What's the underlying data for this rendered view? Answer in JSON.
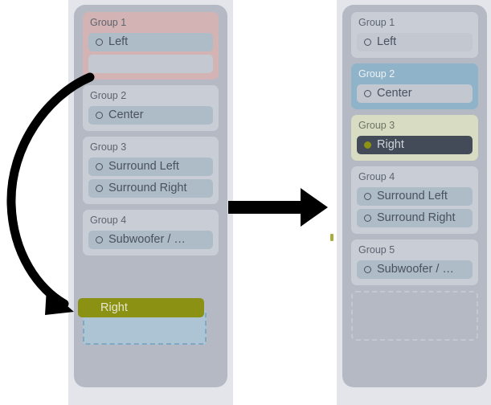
{
  "scene": {
    "description": "Drag-and-drop reordering of speaker channel groups, before and after",
    "accents": {
      "panel_bg": "#b4b9c4",
      "rail_bg": "#e3e5ea",
      "group_bg": "#c9cdd6",
      "group_rose": "#d3b3b3",
      "group_blue": "#8fb3c9",
      "group_olive": "#d8dcc2",
      "chip_bg": "#aebcc8",
      "chip_dark": "#434b58",
      "drag_olive": "#8a9113",
      "drop_fill": "#adc4d4",
      "drop_border": "#7fa8c4"
    }
  },
  "left_panel": {
    "name": "before-state",
    "groups": [
      {
        "title": "Group 1",
        "tint": "rose",
        "items": [
          {
            "label": "Left",
            "style": "chip",
            "bullet": "ring"
          }
        ],
        "ghost_slot": true
      },
      {
        "title": "Group 2",
        "tint": "none",
        "items": [
          {
            "label": "Center",
            "style": "chip",
            "bullet": "ring"
          }
        ],
        "ghost_slot": false
      },
      {
        "title": "Group 3",
        "tint": "none",
        "items": [
          {
            "label": "Surround Left",
            "style": "chip",
            "bullet": "ring"
          },
          {
            "label": "Surround Right",
            "style": "chip",
            "bullet": "ring"
          }
        ],
        "ghost_slot": false
      },
      {
        "title": "Group 4",
        "tint": "none",
        "items": [
          {
            "label": "Subwoofer / …",
            "style": "chip",
            "bullet": "ring"
          }
        ],
        "ghost_slot": false
      }
    ],
    "drag_chip_label": "Right",
    "drop_zone_label": ""
  },
  "right_panel": {
    "name": "after-state",
    "groups": [
      {
        "title": "Group 1",
        "tint": "none",
        "items": [
          {
            "label": "Left",
            "style": "chip-plain",
            "bullet": "ring"
          }
        ],
        "ghost_slot": false
      },
      {
        "title": "Group 2",
        "tint": "blue",
        "items": [
          {
            "label": "Center",
            "style": "chip-plain",
            "bullet": "ring"
          }
        ],
        "ghost_slot": false
      },
      {
        "title": "Group 3",
        "tint": "olive",
        "items": [
          {
            "label": "Right",
            "style": "chip-dark",
            "bullet": "dot"
          }
        ],
        "ghost_slot": false
      },
      {
        "title": "Group 4",
        "tint": "none",
        "items": [
          {
            "label": "Surround Left",
            "style": "chip",
            "bullet": "ring"
          },
          {
            "label": "Surround Right",
            "style": "chip",
            "bullet": "ring"
          }
        ],
        "ghost_slot": false
      },
      {
        "title": "Group 5",
        "tint": "none",
        "items": [
          {
            "label": "Subwoofer / …",
            "style": "chip",
            "bullet": "ring"
          }
        ],
        "ghost_slot": false
      }
    ],
    "empty_group_placeholder": true
  },
  "annotations": {
    "straight_arrow": "transition-arrow",
    "curved_arrow": "drag-path-arrow",
    "edge_marker": "edge-drop-indicator"
  }
}
